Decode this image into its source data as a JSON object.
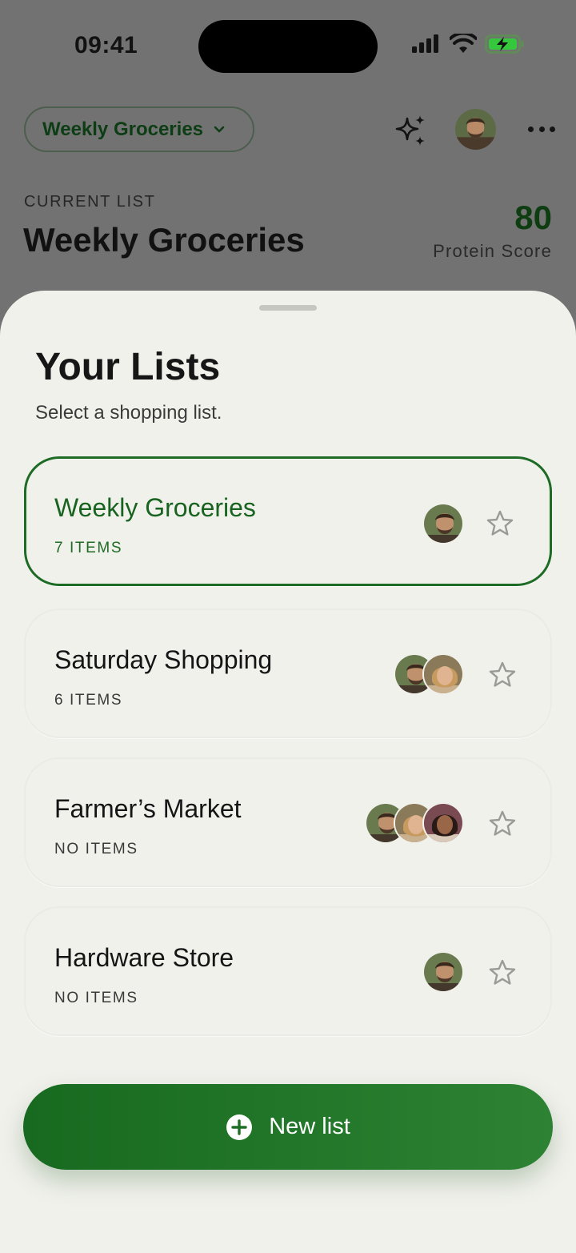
{
  "status_bar": {
    "time": "09:41"
  },
  "header": {
    "selector_label": "Weekly Groceries",
    "current_label": "CURRENT LIST",
    "current_title": "Weekly Groceries",
    "score_value": "80",
    "score_label": "Protein Score",
    "icons": [
      "sparkle-icon",
      "avatar",
      "more-icon",
      "chevron-down-icon"
    ]
  },
  "sheet": {
    "title": "Your Lists",
    "subtitle": "Select a shopping list.",
    "lists": [
      {
        "name": "Weekly Groceries",
        "count": "7 ITEMS",
        "selected": true,
        "members": 1
      },
      {
        "name": "Saturday Shopping",
        "count": "6 ITEMS",
        "selected": false,
        "members": 2
      },
      {
        "name": "Farmer’s Market",
        "count": "NO ITEMS",
        "selected": false,
        "members": 3
      },
      {
        "name": "Hardware Store",
        "count": "NO ITEMS",
        "selected": false,
        "members": 1
      }
    ],
    "new_list_label": "New list"
  },
  "colors": {
    "accent": "#1e6b25",
    "sheet_bg": "#f1f1ec",
    "backdrop": "#727272"
  }
}
